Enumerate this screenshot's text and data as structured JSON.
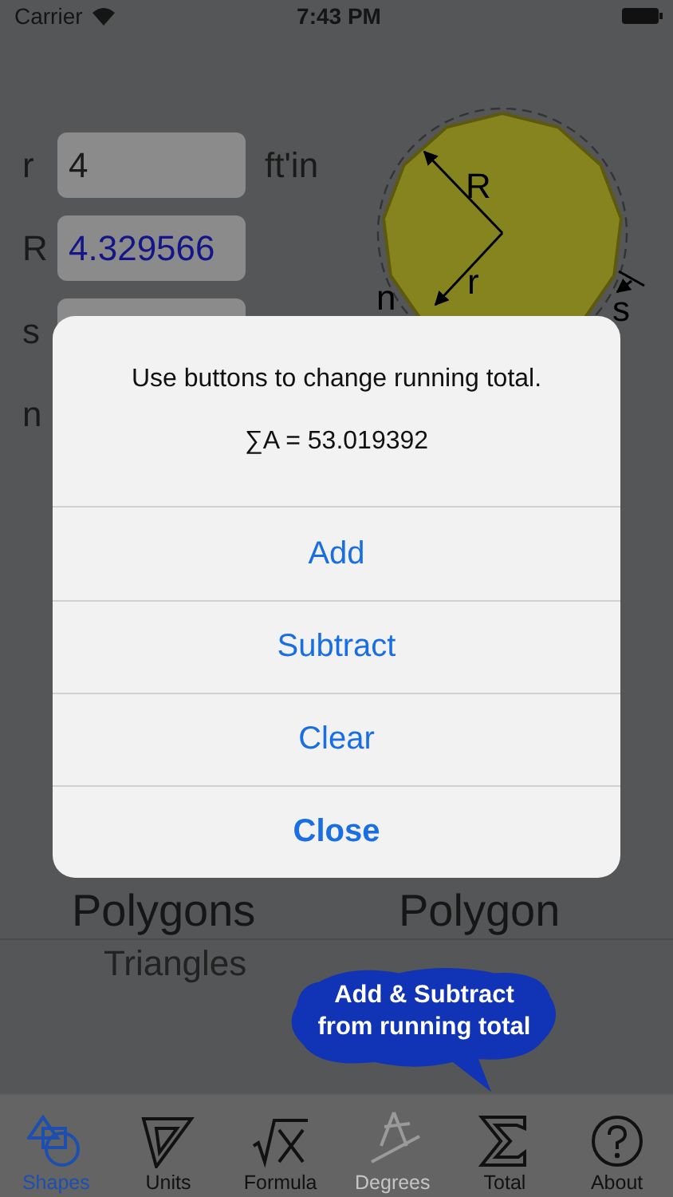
{
  "status_bar": {
    "carrier": "Carrier",
    "time": "7:43 PM"
  },
  "rows": [
    {
      "kind": "field",
      "label": "r",
      "value": "4",
      "unit": "ft'in",
      "computed": false
    },
    {
      "kind": "field",
      "label": "R",
      "value": "4.329566",
      "computed": true
    },
    {
      "kind": "field",
      "label": "s"
    },
    {
      "kind": "label",
      "label": "n"
    }
  ],
  "diagram_labels": [
    "R",
    "n",
    "r",
    "s"
  ],
  "picker": [
    {
      "rows": [
        {
          "text": "Polygons",
          "selected": true
        },
        {
          "text": "Triangles",
          "selected": false
        }
      ]
    },
    {
      "rows": [
        {
          "text": "Polygon",
          "selected": true
        }
      ]
    }
  ],
  "callout": "Add & Subtract from running total",
  "dialog": {
    "message": "Use buttons to change running total.",
    "detail": "∑A = 53.019392",
    "buttons": [
      {
        "label": "Add",
        "kind": "action"
      },
      {
        "label": "Subtract",
        "kind": "action"
      },
      {
        "label": "Clear",
        "kind": "action"
      },
      {
        "label": "Close",
        "kind": "cancel"
      }
    ]
  },
  "tabs": [
    {
      "label": "Shapes",
      "kind": "shapes",
      "selected": true,
      "disabled": false
    },
    {
      "label": "Units",
      "kind": "units",
      "selected": false,
      "disabled": false
    },
    {
      "label": "Formula",
      "kind": "formula",
      "selected": false,
      "disabled": false
    },
    {
      "label": "Degrees",
      "kind": "degrees",
      "selected": false,
      "disabled": true
    },
    {
      "label": "Total",
      "kind": "total",
      "selected": false,
      "disabled": false
    },
    {
      "label": "About",
      "kind": "about",
      "selected": false,
      "disabled": false
    }
  ]
}
